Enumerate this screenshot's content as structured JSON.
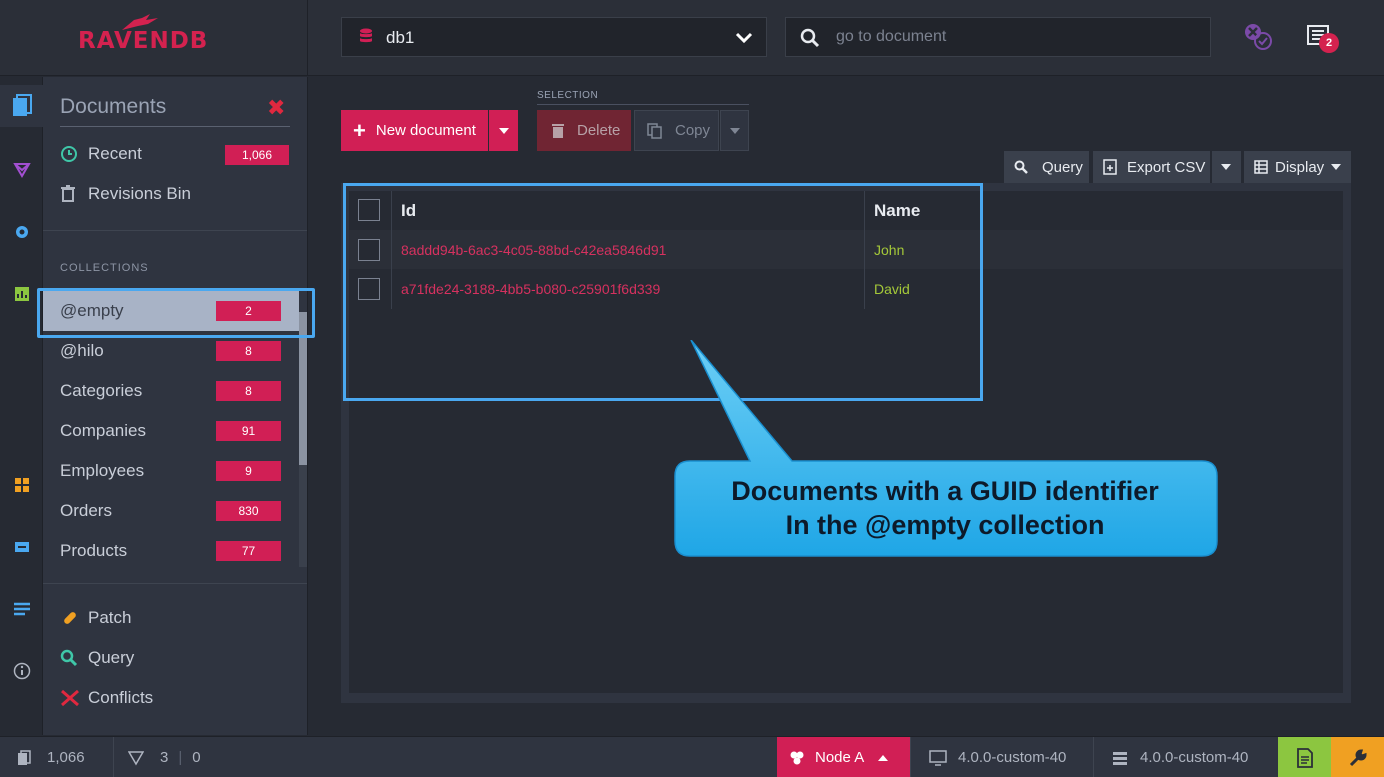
{
  "app": {
    "logo_text": "RAVENDB",
    "brand_color": "#d4224f",
    "accent_color": "#d11f55",
    "highlight_color": "#4aa8f0"
  },
  "topbar": {
    "database": "db1",
    "search": {
      "placeholder": "go to document",
      "value": ""
    },
    "notifications_count": "2"
  },
  "rail": {
    "icons": [
      "documents-icon",
      "indexes-icon",
      "settings-icon",
      "stats-icon",
      "tasks-icon",
      "manage-icon",
      "admin-icon",
      "about-icon"
    ]
  },
  "sidepanel": {
    "title": "Documents",
    "close_symbol": "✖",
    "top_items": [
      {
        "label": "Recent",
        "count": "1,066",
        "icon": "clock-icon"
      },
      {
        "label": "Revisions Bin",
        "icon": "trash-icon"
      }
    ],
    "collections_header": "COLLECTIONS",
    "collections": [
      {
        "label": "@empty",
        "count": "2",
        "selected": true
      },
      {
        "label": "@hilo",
        "count": "8"
      },
      {
        "label": "Categories",
        "count": "8"
      },
      {
        "label": "Companies",
        "count": "91"
      },
      {
        "label": "Employees",
        "count": "9"
      },
      {
        "label": "Orders",
        "count": "830"
      },
      {
        "label": "Products",
        "count": "77"
      }
    ],
    "bottom_items": [
      {
        "label": "Patch",
        "icon": "patch-icon"
      },
      {
        "label": "Query",
        "icon": "search-icon"
      },
      {
        "label": "Conflicts",
        "icon": "conflicts-icon"
      }
    ]
  },
  "toolbar": {
    "new_document": "New document",
    "selection_label": "SELECTION",
    "delete": "Delete",
    "copy": "Copy",
    "query": "Query",
    "export_csv": "Export CSV",
    "display": "Display"
  },
  "grid": {
    "columns": [
      "Id",
      "Name"
    ],
    "rows": [
      {
        "id": "8addd94b-6ac3-4c05-88bd-c42ea5846d91",
        "name": "John"
      },
      {
        "id": "a71fde24-3188-4bb5-b080-c25901f6d339",
        "name": "David"
      }
    ]
  },
  "callout": {
    "line1": "Documents with a GUID identifier",
    "line2": "In the @empty collection"
  },
  "statusbar": {
    "docs_count": "1,066",
    "indexes_count": "3",
    "errors_count": "0",
    "node": "Node A",
    "client_version": "4.0.0-custom-40",
    "server_version": "4.0.0-custom-40"
  }
}
